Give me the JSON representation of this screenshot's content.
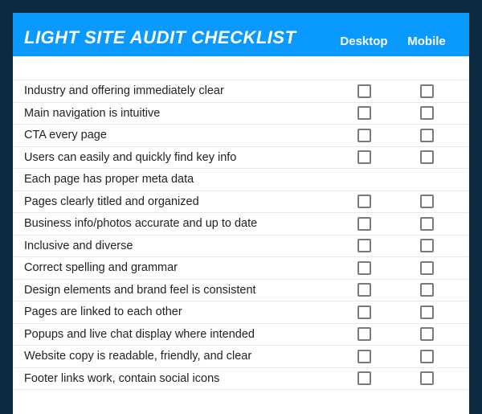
{
  "header": {
    "title": "LIGHT SITE AUDIT CHECKLIST",
    "col1": "Desktop",
    "col2": "Mobile"
  },
  "rows": [
    {
      "label": "",
      "desktop": null,
      "mobile": null
    },
    {
      "label": "Industry and offering immediately clear",
      "desktop": false,
      "mobile": false
    },
    {
      "label": "Main navigation is intuitive",
      "desktop": false,
      "mobile": false
    },
    {
      "label": "CTA every page",
      "desktop": false,
      "mobile": false
    },
    {
      "label": "Users can easily and quickly find key info",
      "desktop": false,
      "mobile": false
    },
    {
      "label": "Each page has proper meta data",
      "desktop": null,
      "mobile": null
    },
    {
      "label": "Pages clearly titled and organized",
      "desktop": false,
      "mobile": false
    },
    {
      "label": "Business info/photos accurate and up to date",
      "desktop": false,
      "mobile": false
    },
    {
      "label": "Inclusive and diverse",
      "desktop": false,
      "mobile": false
    },
    {
      "label": "Correct spelling and grammar",
      "desktop": false,
      "mobile": false
    },
    {
      "label": "Design elements and brand feel is consistent",
      "desktop": false,
      "mobile": false
    },
    {
      "label": "Pages are linked to each other",
      "desktop": false,
      "mobile": false
    },
    {
      "label": "Popups and live chat display where intended",
      "desktop": false,
      "mobile": false
    },
    {
      "label": "Website copy is readable, friendly, and clear",
      "desktop": false,
      "mobile": false
    },
    {
      "label": "Footer links work, contain social icons",
      "desktop": false,
      "mobile": false
    }
  ]
}
